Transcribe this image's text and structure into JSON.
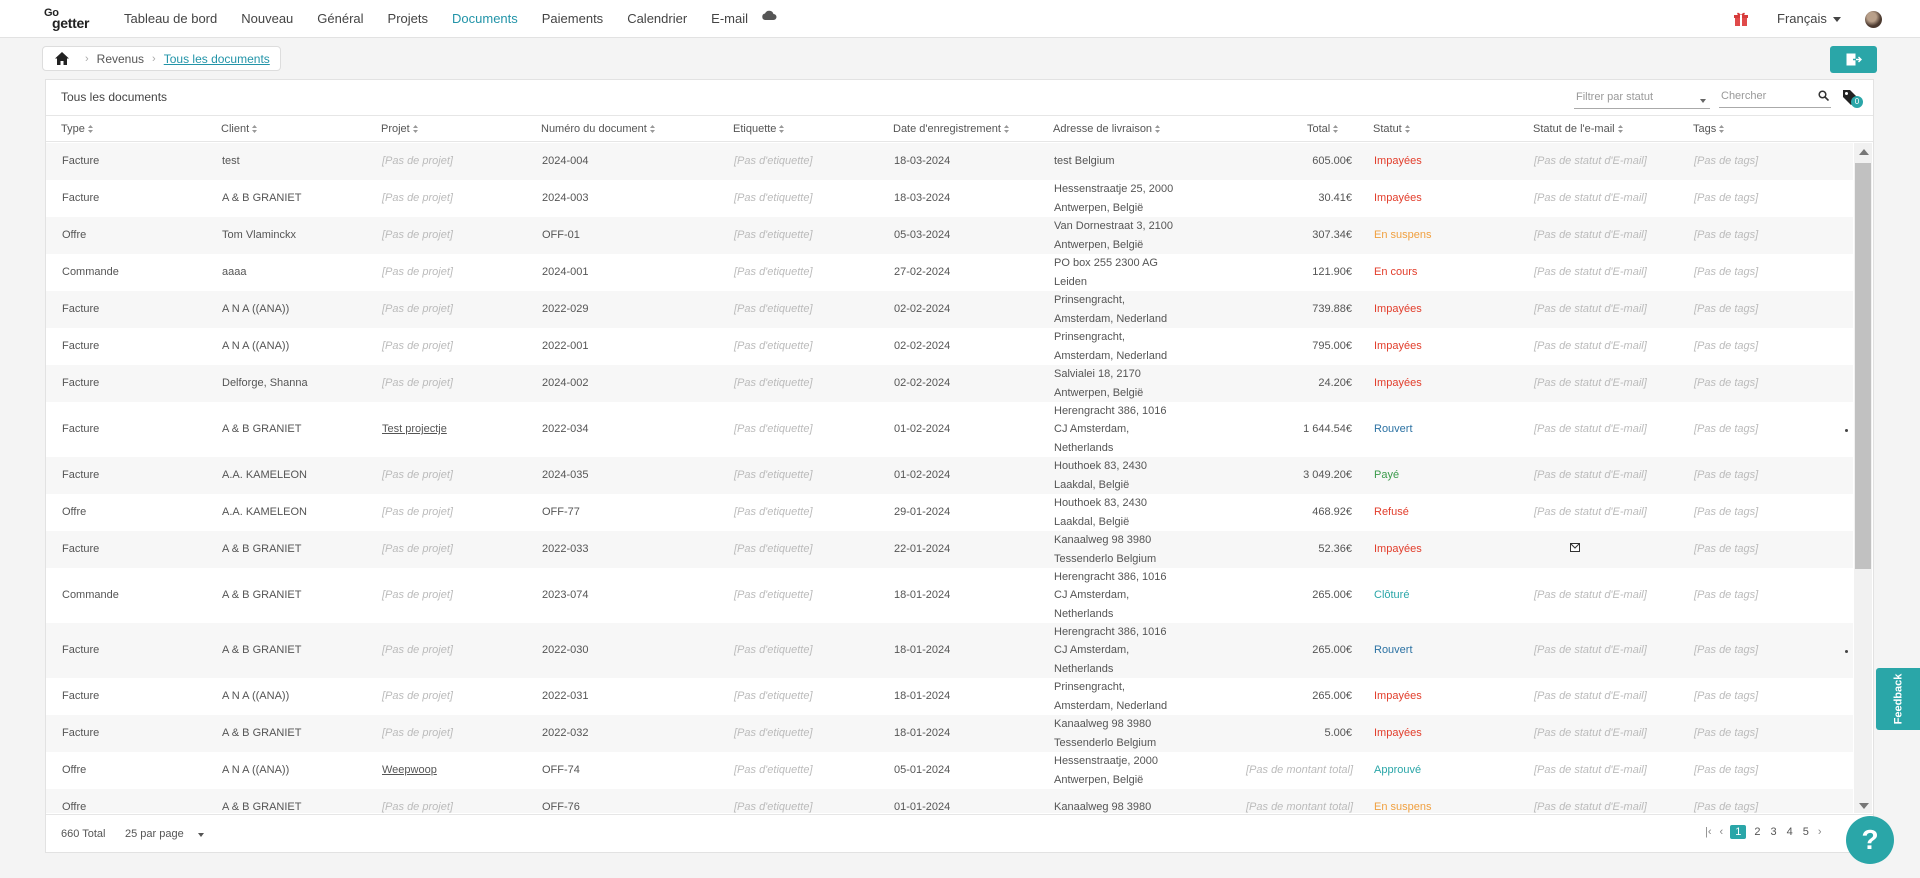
{
  "nav": {
    "logo_top": "Go",
    "logo_bottom": "getter",
    "items": [
      "Tableau de bord",
      "Nouveau",
      "Général",
      "Projets",
      "Documents",
      "Paiements",
      "Calendrier",
      "E-mail"
    ],
    "active": "Documents",
    "language": "Français"
  },
  "breadcrumb": {
    "parent": "Revenus",
    "current": "Tous les documents"
  },
  "card": {
    "title": "Tous les documents",
    "filter_placeholder": "Filtrer par statut",
    "search_placeholder": "Chercher",
    "tag_count": "0"
  },
  "columns": [
    "Type",
    "Client",
    "Projet",
    "Numéro du document",
    "Etiquette",
    "Date d'enregistrement",
    "Adresse de livraison",
    "Total",
    "Statut",
    "Statut de l'e-mail",
    "Tags"
  ],
  "rows": [
    {
      "type": "Facture",
      "client": "test",
      "project": "[Pas de projet]",
      "number": "2024-004",
      "label": "[Pas d'etiquette]",
      "date": "18-03-2024",
      "address": "test Belgium",
      "total": "605.00€",
      "status": "Impayées",
      "email_status": "[Pas de statut d'E-mail]",
      "tags": "[Pas de tags]"
    },
    {
      "type": "Facture",
      "client": "A & B GRANIET",
      "project": "[Pas de projet]",
      "number": "2024-003",
      "label": "[Pas d'etiquette]",
      "date": "18-03-2024",
      "address": "Hessenstraatje 25, 2000 Antwerpen, België",
      "total": "30.41€",
      "status": "Impayées",
      "email_status": "[Pas de statut d'E-mail]",
      "tags": "[Pas de tags]"
    },
    {
      "type": "Offre",
      "client": "Tom Vlaminckx",
      "project": "[Pas de projet]",
      "number": "OFF-01",
      "label": "[Pas d'etiquette]",
      "date": "05-03-2024",
      "address": "Van Dornestraat 3, 2100 Antwerpen, België",
      "total": "307.34€",
      "status": "En suspens",
      "email_status": "[Pas de statut d'E-mail]",
      "tags": "[Pas de tags]"
    },
    {
      "type": "Commande",
      "client": "aaaa",
      "project": "[Pas de projet]",
      "number": "2024-001",
      "label": "[Pas d'etiquette]",
      "date": "27-02-2024",
      "address": "PO box 255 2300 AG Leiden",
      "total": "121.90€",
      "status": "En cours",
      "email_status": "[Pas de statut d'E-mail]",
      "tags": "[Pas de tags]"
    },
    {
      "type": "Facture",
      "client": "A N A ((ANA))",
      "project": "[Pas de projet]",
      "number": "2022-029",
      "label": "[Pas d'etiquette]",
      "date": "02-02-2024",
      "address": "Prinsengracht, Amsterdam, Nederland",
      "total": "739.88€",
      "status": "Impayées",
      "email_status": "[Pas de statut d'E-mail]",
      "tags": "[Pas de tags]"
    },
    {
      "type": "Facture",
      "client": "A N A ((ANA))",
      "project": "[Pas de projet]",
      "number": "2022-001",
      "label": "[Pas d'etiquette]",
      "date": "02-02-2024",
      "address": "Prinsengracht, Amsterdam, Nederland",
      "total": "795.00€",
      "status": "Impayées",
      "email_status": "[Pas de statut d'E-mail]",
      "tags": "[Pas de tags]"
    },
    {
      "type": "Facture",
      "client": "Delforge, Shanna",
      "project": "[Pas de projet]",
      "number": "2024-002",
      "label": "[Pas d'etiquette]",
      "date": "02-02-2024",
      "address": "Salvialei 18, 2170 Antwerpen, België",
      "total": "24.20€",
      "status": "Impayées",
      "email_status": "[Pas de statut d'E-mail]",
      "tags": "[Pas de tags]"
    },
    {
      "type": "Facture",
      "client": "A & B GRANIET",
      "project": "Test projectje",
      "number": "2022-034",
      "label": "[Pas d'etiquette]",
      "date": "01-02-2024",
      "address": "Herengracht 386, 1016 CJ Amsterdam, Netherlands",
      "total": "1 644.54€",
      "status": "Rouvert",
      "email_status": "[Pas de statut d'E-mail]",
      "tags": "[Pas de tags]"
    },
    {
      "type": "Facture",
      "client": "A.A. KAMELEON",
      "project": "[Pas de projet]",
      "number": "2024-035",
      "label": "[Pas d'etiquette]",
      "date": "01-02-2024",
      "address": "Houthoek 83, 2430 Laakdal, België",
      "total": "3 049.20€",
      "status": "Payé",
      "email_status": "[Pas de statut d'E-mail]",
      "tags": "[Pas de tags]"
    },
    {
      "type": "Offre",
      "client": "A.A. KAMELEON",
      "project": "[Pas de projet]",
      "number": "OFF-77",
      "label": "[Pas d'etiquette]",
      "date": "29-01-2024",
      "address": "Houthoek 83, 2430 Laakdal, België",
      "total": "468.92€",
      "status": "Refusé",
      "email_status": "[Pas de statut d'E-mail]",
      "tags": "[Pas de tags]"
    },
    {
      "type": "Facture",
      "client": "A & B GRANIET",
      "project": "[Pas de projet]",
      "number": "2022-033",
      "label": "[Pas d'etiquette]",
      "date": "22-01-2024",
      "address": "Kanaalweg 98 3980 Tessenderlo Belgium",
      "total": "52.36€",
      "status": "Impayées",
      "email_status": "",
      "tags": "[Pas de tags]"
    },
    {
      "type": "Commande",
      "client": "A & B GRANIET",
      "project": "[Pas de projet]",
      "number": "2023-074",
      "label": "[Pas d'etiquette]",
      "date": "18-01-2024",
      "address": "Herengracht 386, 1016 CJ Amsterdam, Netherlands",
      "total": "265.00€",
      "status": "Clôturé",
      "email_status": "[Pas de statut d'E-mail]",
      "tags": "[Pas de tags]"
    },
    {
      "type": "Facture",
      "client": "A & B GRANIET",
      "project": "[Pas de projet]",
      "number": "2022-030",
      "label": "[Pas d'etiquette]",
      "date": "18-01-2024",
      "address": "Herengracht 386, 1016 CJ Amsterdam, Netherlands",
      "total": "265.00€",
      "status": "Rouvert",
      "email_status": "[Pas de statut d'E-mail]",
      "tags": "[Pas de tags]"
    },
    {
      "type": "Facture",
      "client": "A N A ((ANA))",
      "project": "[Pas de projet]",
      "number": "2022-031",
      "label": "[Pas d'etiquette]",
      "date": "18-01-2024",
      "address": "Prinsengracht, Amsterdam, Nederland",
      "total": "265.00€",
      "status": "Impayées",
      "email_status": "[Pas de statut d'E-mail]",
      "tags": "[Pas de tags]"
    },
    {
      "type": "Facture",
      "client": "A & B GRANIET",
      "project": "[Pas de projet]",
      "number": "2022-032",
      "label": "[Pas d'etiquette]",
      "date": "18-01-2024",
      "address": "Kanaalweg 98 3980 Tessenderlo Belgium",
      "total": "5.00€",
      "status": "Impayées",
      "email_status": "[Pas de statut d'E-mail]",
      "tags": "[Pas de tags]"
    },
    {
      "type": "Offre",
      "client": "A N A ((ANA))",
      "project": "Weepwoop",
      "number": "OFF-74",
      "label": "[Pas d'etiquette]",
      "date": "05-01-2024",
      "address": "Hessenstraatje, 2000 Antwerpen, België",
      "total": "[Pas de montant total]",
      "status": "Approuvé",
      "email_status": "[Pas de statut d'E-mail]",
      "tags": "[Pas de tags]"
    },
    {
      "type": "Offre",
      "client": "A & B GRANIET",
      "project": "[Pas de projet]",
      "number": "OFF-76",
      "label": "[Pas d'etiquette]",
      "date": "01-01-2024",
      "address": "Kanaalweg 98 3980",
      "total": "[Pas de montant total]",
      "status": "En suspens",
      "email_status": "[Pas de statut d'E-mail]",
      "tags": "[Pas de tags]"
    }
  ],
  "status_colors": {
    "Impayées": "#e23d2b",
    "En suspens": "#f0a040",
    "En cours": "#e2603a",
    "Rouvert": "#2c72a3",
    "Payé": "#3a9a4a",
    "Refusé": "#e23d2b",
    "Clôturé": "#2aa6a8",
    "Approuvé": "#2aa6a8"
  },
  "footer": {
    "total": "660 Total",
    "per_page": "25 par page",
    "pages": [
      "1",
      "2",
      "3",
      "4",
      "5"
    ],
    "active_page": "1"
  },
  "feedback_label": "Feedback",
  "help_label": "?"
}
